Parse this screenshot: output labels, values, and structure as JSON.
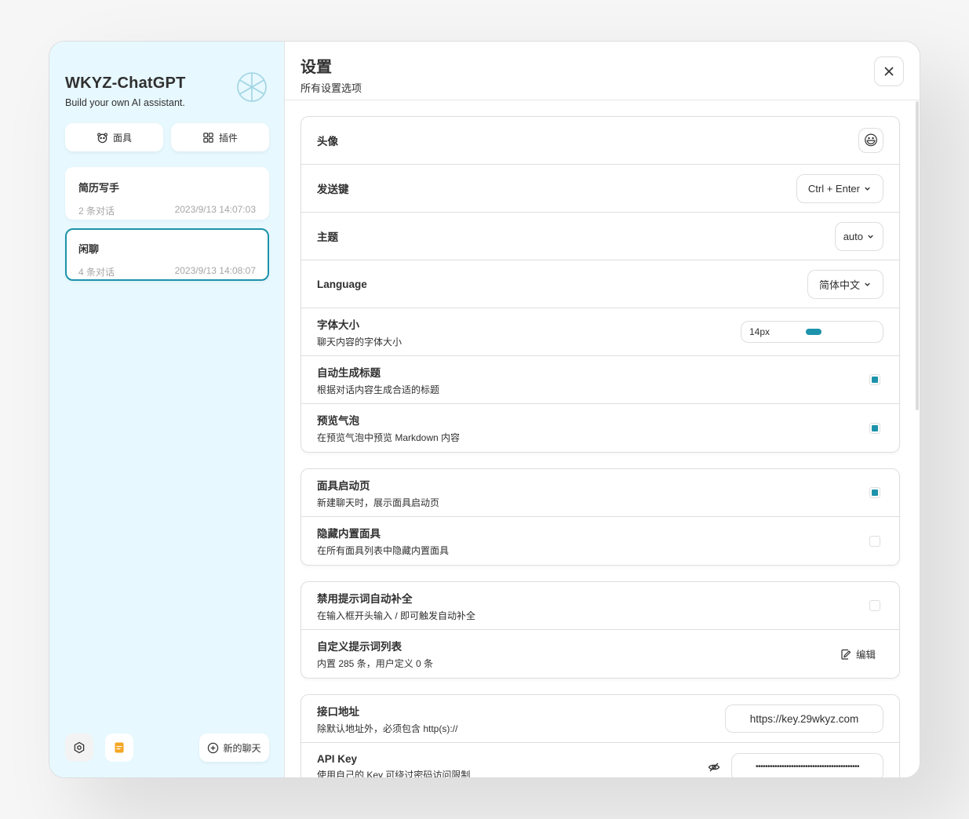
{
  "sidebar": {
    "title": "WKYZ-ChatGPT",
    "subtitle": "Build your own AI assistant.",
    "buttons": {
      "masks": "面具",
      "plugins": "插件"
    },
    "chats": [
      {
        "title": "简历写手",
        "count": "2 条对话",
        "time": "2023/9/13 14:07:03",
        "selected": false
      },
      {
        "title": "闲聊",
        "count": "4 条对话",
        "time": "2023/9/13 14:08:07",
        "selected": true
      }
    ],
    "new_chat": "新的聊天"
  },
  "header": {
    "title": "设置",
    "subtitle": "所有设置选项"
  },
  "settings": {
    "avatar": {
      "label": "头像",
      "emoji": "😃"
    },
    "send_key": {
      "label": "发送键",
      "value": "Ctrl + Enter"
    },
    "theme": {
      "label": "主题",
      "value": "auto"
    },
    "language": {
      "label": "Language",
      "value": "简体中文"
    },
    "font_size": {
      "label": "字体大小",
      "sub": "聊天内容的字体大小",
      "value": "14px"
    },
    "auto_title": {
      "label": "自动生成标题",
      "sub": "根据对话内容生成合适的标题",
      "checked": true
    },
    "preview_bubble": {
      "label": "预览气泡",
      "sub": "在预览气泡中预览 Markdown 内容",
      "checked": true
    },
    "mask_launch": {
      "label": "面具启动页",
      "sub": "新建聊天时，展示面具启动页",
      "checked": true
    },
    "hide_builtin": {
      "label": "隐藏内置面具",
      "sub": "在所有面具列表中隐藏内置面具",
      "checked": false
    },
    "disable_prompt": {
      "label": "禁用提示词自动补全",
      "sub": "在输入框开头输入 / 即可触发自动补全",
      "checked": false
    },
    "custom_prompts": {
      "label": "自定义提示词列表",
      "sub": "内置 285 条，用户定义 0 条",
      "action": "编辑"
    },
    "endpoint": {
      "label": "接口地址",
      "sub": "除默认地址外，必须包含 http(s)://",
      "value": "https://key.29wkyz.com"
    },
    "api_key": {
      "label": "API Key",
      "sub": "使用自己的 Key 可绕过密码访问限制",
      "value": "••••••••••••••••••••••••••••••••••••••••••••"
    }
  },
  "colors": {
    "accent": "#1d93ab",
    "sidebar_bg": "#e7f8ff"
  }
}
